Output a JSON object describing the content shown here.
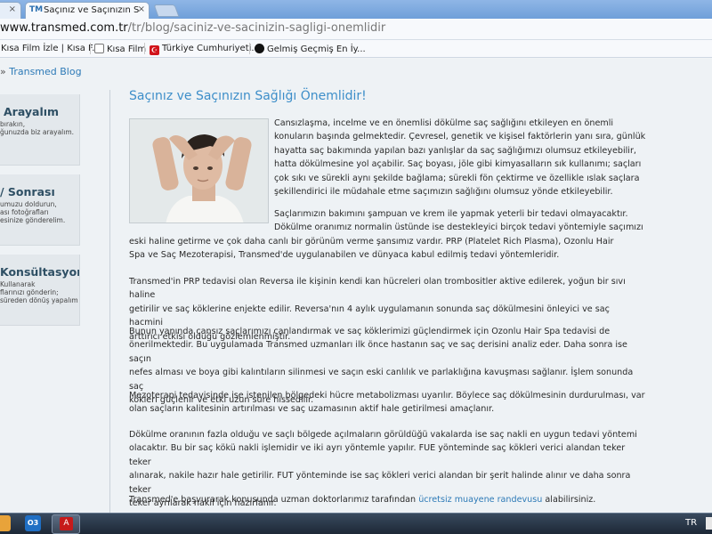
{
  "browser": {
    "prev_tab_close": "×",
    "active_tab": {
      "favicon": "TM",
      "title": "Saçınız ve Saçınızın Sağlığı Ö",
      "close": "×"
    },
    "url_host": "www.transmed.com.tr",
    "url_path": "/tr/blog/saciniz-ve-sacinizin-sagligi-onemlidir",
    "bookmarks": [
      {
        "label": "Kısa Film İzle | Kısa F...",
        "icon": "film-icon"
      },
      {
        "label": "Kısa Film",
        "icon": "film-icon"
      },
      {
        "label": "Türkiye Cumhuriyeti...",
        "icon": "flag-icon"
      },
      {
        "label": "Gelmiş Geçmiş En İy...",
        "icon": "globe-icon"
      }
    ]
  },
  "breadcrumb": {
    "sep": "»",
    "label": "Transmed Blog"
  },
  "sidebar": [
    {
      "title": "Arayalım",
      "lines": [
        "bırakın,",
        "ğunuzda biz arayalım."
      ]
    },
    {
      "title": "/ Sonrası",
      "lines": [
        "umuzu doldurun,",
        "ası fotoğrafları",
        "esinize gönderelim."
      ]
    },
    {
      "title": "Konsültasyon",
      "lines": [
        "Kullanarak",
        "flarınızı gönderin;",
        "süreden dönüş yapalım"
      ]
    }
  ],
  "article": {
    "title": "Saçınız ve Saçınızın Sağlığı Önemlidir!",
    "intro_lines": [
      "Cansızlaşma, incelme ve en önemlisi dökülme saç sağlığını etkileyen en önemli",
      "konuların başında gelmektedir. Çevresel, genetik ve kişisel faktörlerin yanı sıra, günlük",
      "hayatta saç bakımında yapılan bazı yanlışlar da saç sağlığımızı olumsuz etkileyebilir,",
      "hatta dökülmesine yol açabilir. Saç boyası, jöle gibi kimyasalların sık kullanımı; saçları",
      "çok sıkı ve sürekli aynı şekilde bağlama; sürekli fön çektirme ve özellikle ıslak saçlara",
      "şekillendirici ile müdahale etme saçımızın sağlığını olumsuz yönde etkileyebilir."
    ],
    "p2_short": [
      "Saçlarımızın bakımını şampuan ve krem ile yapmak yeterli bir tedavi olmayacaktır.",
      "Dökülme oranımız normalin üstünde ise destekleyici birçok tedavi yöntemiyle saçımızı"
    ],
    "p2_long": [
      "eski haline getirme ve çok daha canlı bir görünüm verme şansımız vardır. PRP (Platelet Rich Plasma), Ozonlu Hair",
      "Spa ve Saç Mezoterapisi, Transmed'de uygulanabilen ve dünyaca kabul edilmiş tedavi yöntemleridir."
    ],
    "p3": [
      "Transmed'in PRP tedavisi olan Reversa ile kişinin kendi kan hücreleri olan trombositler aktive edilerek, yoğun bir sıvı haline",
      "getirilir ve saç köklerine enjekte edilir. Reversa'nın 4 aylık uygulamanın sonunda saç dökülmesini önleyici ve saç hacmini",
      "arttırıcı etkisi olduğu gözlemlenmiştir."
    ],
    "p4": [
      "Bunun yanında cansız saçlarımızı canlandırmak ve saç köklerimizi güçlendirmek için Ozonlu Hair Spa tedavisi de",
      "önerilmektedir. Bu uygulamada Transmed uzmanları ilk önce hastanın saç ve saç derisini analiz eder. Daha sonra ise saçın",
      "nefes alması ve boya gibi kalıntıların silinmesi ve saçın eski canlılık ve parlaklığına kavuşması sağlanır. İşlem sonunda saç",
      "kökleri güçlenir ve etki uzun süre hissedilir."
    ],
    "p5": [
      "Mezoterapi tedavisinde ise istenilen bölgedeki hücre metabolizması uyarılır. Böylece saç dökülmesinin durdurulması, var",
      "olan saçların kalitesinin artırılması ve saç uzamasının aktif hale getirilmesi amaçlanır."
    ],
    "p6": [
      "Dökülme oranının fazla olduğu ve saçlı bölgede açılmaların görüldüğü vakalarda ise saç nakli en uygun tedavi yöntemi",
      "olacaktır. Bu bir saç kökü nakli işlemidir ve iki ayrı yöntemle yapılır. FUE yönteminde saç kökleri verici alandan teker teker",
      "alınarak, nakile hazır hale getirilir. FUT yönteminde ise saç kökleri verici alandan bir şerit halinde alınır ve daha sonra teker",
      "teker ayrılarak nakil için hazırlanır."
    ],
    "p7": {
      "before": "Transmed'e başvurarak konusunda uzman doktorlarımız tarafından ",
      "link": "ücretsiz muayene randevusu",
      "after": " alabilirsiniz."
    }
  },
  "taskbar": {
    "outlook_label": "O3",
    "acrobat_label": "A",
    "language": "TR"
  }
}
